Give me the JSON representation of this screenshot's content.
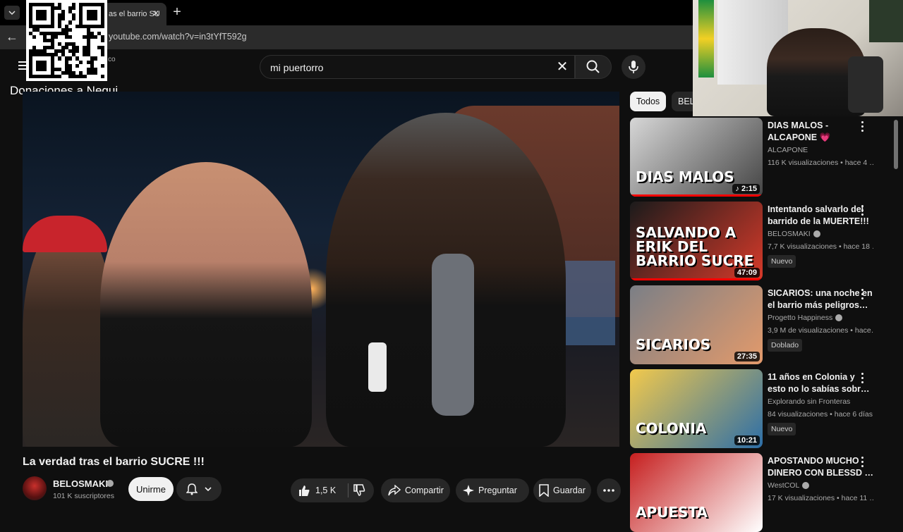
{
  "browser": {
    "tab_title": "as el barrio SU",
    "url": "youtube.com/watch?v=in3tYfT592g"
  },
  "header": {
    "logo_fragment": "co",
    "search_value": "mi puertorro"
  },
  "overlay": {
    "donations_text": "Donaciones a Nequi"
  },
  "video": {
    "title": "La verdad tras el barrio SUCRE !!!",
    "channel": "BELOSMAKI",
    "subscribers": "101 K suscriptores",
    "join_label": "Unirme",
    "likes": "1,5 K",
    "share_label": "Compartir",
    "ask_label": "Preguntar",
    "save_label": "Guardar"
  },
  "chips": {
    "all": "Todos",
    "second": "BEL"
  },
  "recommendations": [
    {
      "title": "DIAS MALOS - ALCAPONE 💗",
      "channel": "ALCAPONE",
      "views": "116 K visualizaciones • hace 4 …",
      "duration": "♪ 2:15",
      "thumb_text": "DIAS MALOS",
      "thumb_colors": [
        "#d7d7d7",
        "#444444"
      ]
    },
    {
      "title": "Intentando salvarlo del barrido de la MUERTE!!!",
      "channel": "BELOSMAKI",
      "views": "7,7 K visualizaciones • hace 18 …",
      "duration": "47:09",
      "badge": "Nuevo",
      "thumb_text": "SALVANDO A ERIK DEL BARRIO SUCRE",
      "thumb_colors": [
        "#1b1b1b",
        "#d73a2a"
      ]
    },
    {
      "title": "SICARIOS: una noche en el barrio más peligros…",
      "channel": "Progetto Happiness",
      "views": "3,9 M de visualizaciones • hace…",
      "duration": "27:35",
      "badge": "Doblado",
      "thumb_text": "SICARIOS",
      "thumb_colors": [
        "#7b7f86",
        "#e39a6b"
      ]
    },
    {
      "title": "11 años en Colonia y esto no lo sabías sobr…",
      "channel": "Explorando sin Fronteras",
      "views": "84 visualizaciones • hace 6 días",
      "duration": "10:21",
      "badge": "Nuevo",
      "thumb_text": "COLONIA",
      "thumb_colors": [
        "#f2c94c",
        "#2c6ea8"
      ]
    },
    {
      "title": "APOSTANDO MUCHO DINERO CON BLESSD …",
      "channel": "WestCOL",
      "views": "17 K visualizaciones • hace 11 …",
      "duration": "",
      "thumb_text": "APUESTA",
      "thumb_colors": [
        "#c61f1f",
        "#ffffff"
      ]
    }
  ]
}
